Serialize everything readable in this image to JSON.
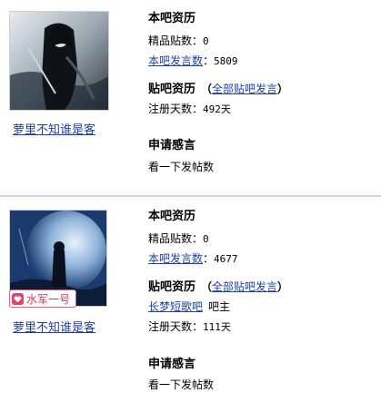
{
  "colors": {
    "link": "#1f3fa6",
    "divider": "#d3d3d3",
    "badge": "#d23b5e"
  },
  "cards": [
    {
      "username": "萝里不知谁是客",
      "local_history_title": "本吧资历",
      "elite_label": "精品贴数：",
      "elite_value": "0",
      "posts_link": "本吧发言数",
      "posts_colon": "：",
      "posts_value": "5809",
      "tieba_history_title": "贴吧资历",
      "all_posts_link": "全部贴吧发言",
      "reg_label": "注册天数：",
      "reg_value": "492天",
      "apply_title": "申请感言",
      "apply_text": "看一下发帖数"
    },
    {
      "username": "萝里不知谁是客",
      "badge_text": "水军一号",
      "local_history_title": "本吧资历",
      "elite_label": "精品贴数：",
      "elite_value": "0",
      "posts_link": "本吧发言数",
      "posts_colon": "：",
      "posts_value": "4677",
      "tieba_history_title": "贴吧资历",
      "all_posts_link": "全部贴吧发言",
      "bar_link": "长梦短歌吧",
      "bar_role": "吧主",
      "reg_label": "注册天数：",
      "reg_value": "111天",
      "apply_title": "申请感言",
      "apply_text": "看一下发帖数"
    }
  ]
}
